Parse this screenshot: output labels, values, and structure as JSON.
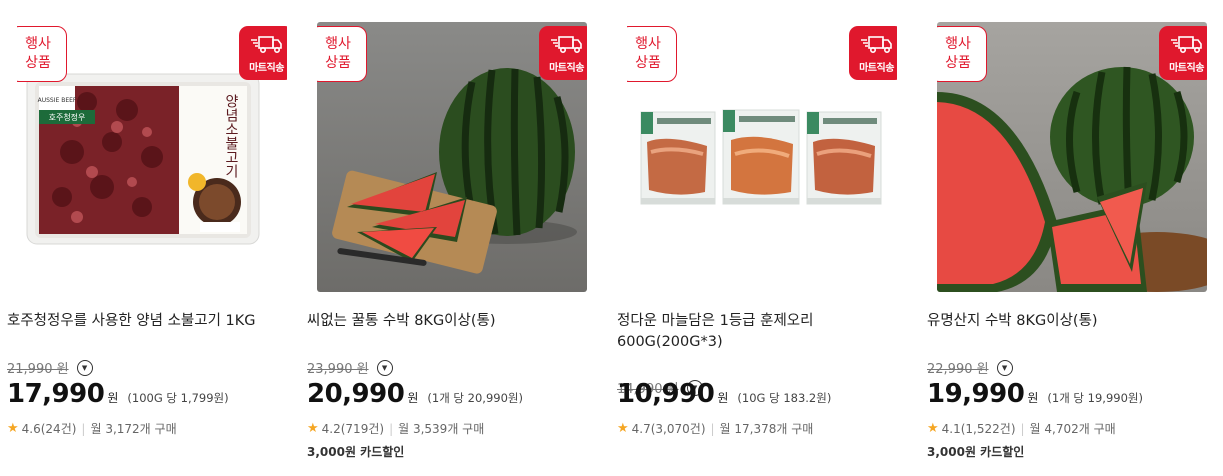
{
  "products": [
    {
      "event_badge": [
        "행사",
        "상품"
      ],
      "delivery_badge": "마트직송",
      "title": "호주청정우를 사용한 양념 소불고기 1KG",
      "original_price": "21,990 원",
      "price": "17,990",
      "currency": "원",
      "unit_price": "(100G 당 1,799원)",
      "rating": "4.6(24건)",
      "monthly_purchase": "월 3,172개 구매",
      "card_discount": "",
      "image": "marinated-beef-bulgogi-tray",
      "package_text": [
        "양념소불고기",
        "호주청정우",
        "AUSSIE BEEF"
      ]
    },
    {
      "event_badge": [
        "행사",
        "상품"
      ],
      "delivery_badge": "마트직송",
      "title": "씨없는 꿀통 수박 8KG이상(통)",
      "original_price": "23,990 원",
      "price": "20,990",
      "currency": "원",
      "unit_price": "(1개 당 20,990원)",
      "rating": "4.2(719건)",
      "monthly_purchase": "월 3,539개 구매",
      "card_discount": "3,000원 카드할인",
      "image": "watermelon-on-board"
    },
    {
      "event_badge": [
        "행사",
        "상품"
      ],
      "delivery_badge": "마트직송",
      "title": "정다운 마늘담은 1등급 훈제오리 600G(200G*3)",
      "original_price": "14,990 원",
      "price": "10,990",
      "currency": "원",
      "unit_price": "(10G 당 183.2원)",
      "rating": "4.7(3,070건)",
      "monthly_purchase": "월 17,378개 구매",
      "card_discount": "",
      "image": "smoked-duck-packs"
    },
    {
      "event_badge": [
        "행사",
        "상품"
      ],
      "delivery_badge": "마트직송",
      "title": "유명산지 수박 8KG이상(통)",
      "original_price": "22,990 원",
      "price": "19,990",
      "currency": "원",
      "unit_price": "(1개 당 19,990원)",
      "rating": "4.1(1,522건)",
      "monthly_purchase": "월 4,702개 구매",
      "card_discount": "3,000원 카드할인",
      "image": "watermelon-slices"
    }
  ],
  "colors": {
    "accent": "#e0182d",
    "star": "#f5a623"
  }
}
